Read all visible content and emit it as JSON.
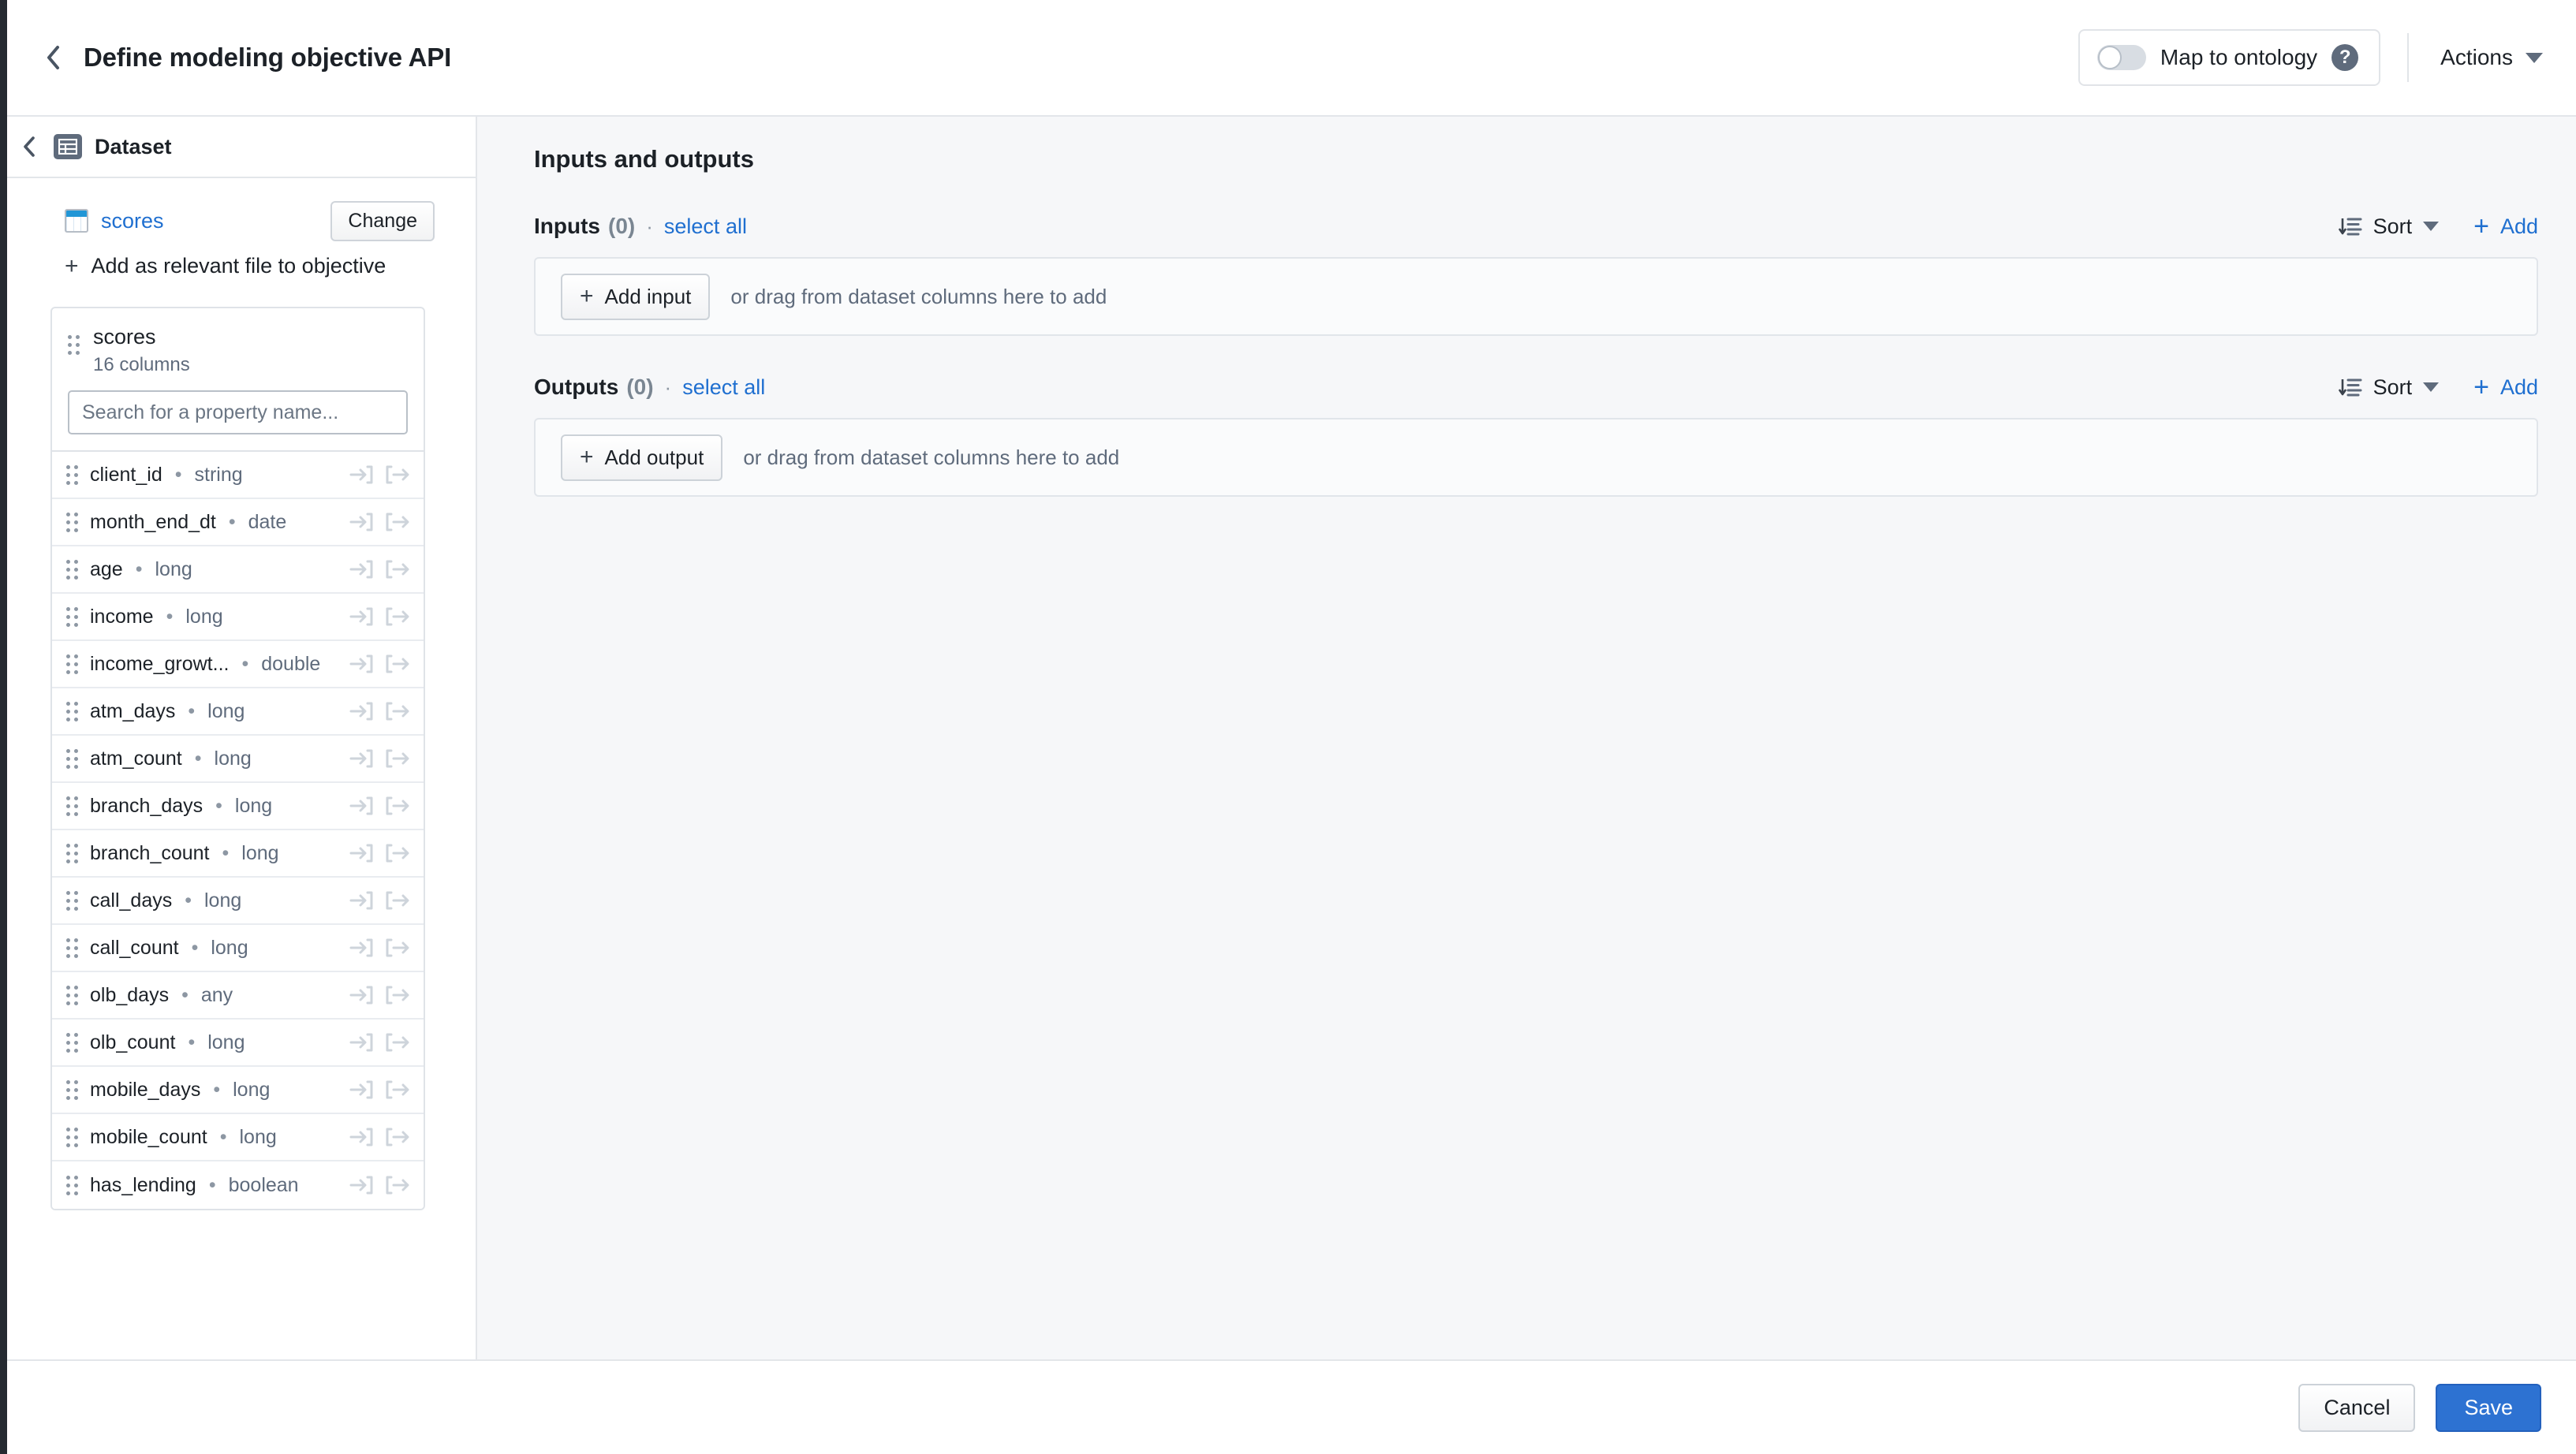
{
  "header": {
    "title": "Define modeling objective API",
    "back_icon": "chevron-left-icon",
    "ontology_toggle_label": "Map to ontology",
    "ontology_toggle_state": "off",
    "help_icon_glyph": "?",
    "actions_label": "Actions"
  },
  "sidebar": {
    "back_icon": "chevron-left-icon",
    "head_label": "Dataset",
    "dataset_name": "scores",
    "change_label": "Change",
    "add_relevant_label": "Add as relevant file to objective",
    "card": {
      "title": "scores",
      "subtitle": "16 columns",
      "search_placeholder": "Search for a property name...",
      "search_value": ""
    },
    "columns": [
      {
        "name": "client_id",
        "type": "string"
      },
      {
        "name": "month_end_dt",
        "type": "date"
      },
      {
        "name": "age",
        "type": "long"
      },
      {
        "name": "income",
        "type": "long"
      },
      {
        "name": "income_growt...",
        "type": "double"
      },
      {
        "name": "atm_days",
        "type": "long"
      },
      {
        "name": "atm_count",
        "type": "long"
      },
      {
        "name": "branch_days",
        "type": "long"
      },
      {
        "name": "branch_count",
        "type": "long"
      },
      {
        "name": "call_days",
        "type": "long"
      },
      {
        "name": "call_count",
        "type": "long"
      },
      {
        "name": "olb_days",
        "type": "any"
      },
      {
        "name": "olb_count",
        "type": "long"
      },
      {
        "name": "mobile_days",
        "type": "long"
      },
      {
        "name": "mobile_count",
        "type": "long"
      },
      {
        "name": "has_lending",
        "type": "boolean"
      }
    ],
    "row_separator": "•"
  },
  "main": {
    "title": "Inputs and outputs",
    "sections": [
      {
        "label": "Inputs",
        "count": "(0)",
        "separator": "·",
        "select_all_label": "select all",
        "sort_label": "Sort",
        "add_label": "Add",
        "add_plus": "+",
        "dropzone_button": "Add input",
        "dropzone_button_plus": "+",
        "dropzone_hint": "or drag from dataset columns here to add"
      },
      {
        "label": "Outputs",
        "count": "(0)",
        "separator": "·",
        "select_all_label": "select all",
        "sort_label": "Sort",
        "add_label": "Add",
        "add_plus": "+",
        "dropzone_button": "Add output",
        "dropzone_button_plus": "+",
        "dropzone_hint": "or drag from dataset columns here to add"
      }
    ]
  },
  "footer": {
    "cancel_label": "Cancel",
    "save_label": "Save"
  },
  "colors": {
    "accent_blue": "#2d72d2",
    "link_blue": "#1f6fd0",
    "dark_rail": "#252a31",
    "main_bg": "#f6f7f9",
    "muted_text": "#5f6b7c"
  }
}
